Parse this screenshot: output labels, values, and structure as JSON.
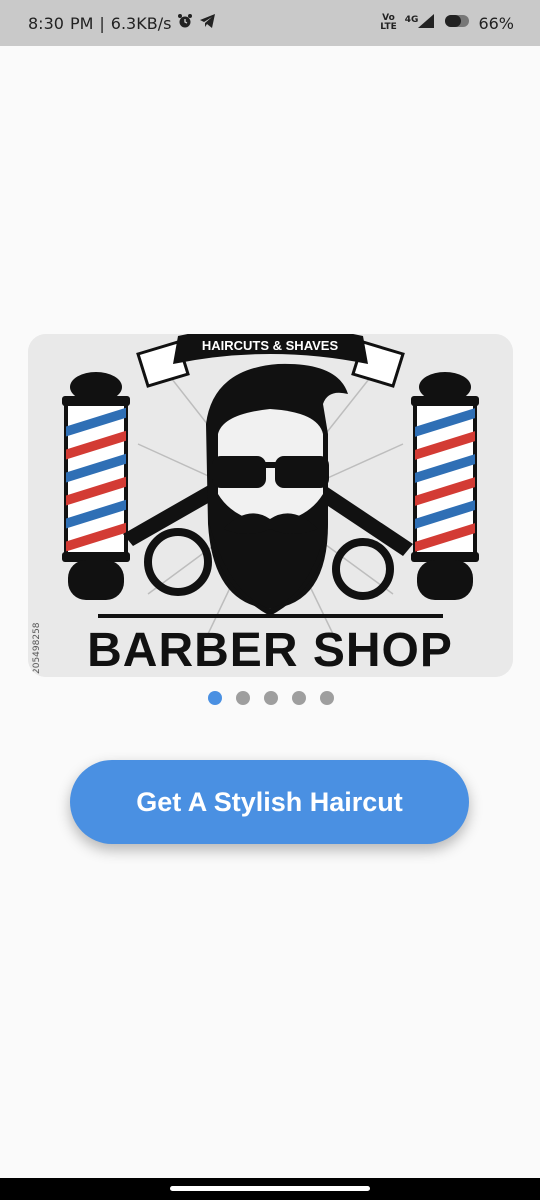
{
  "status_bar": {
    "time": "8:30",
    "ampm": "PM",
    "separator": "|",
    "net_speed": "6.3KB/s",
    "volte_top": "Vo",
    "volte_bottom": "LTE",
    "network_type": "4G",
    "battery": "66%"
  },
  "banner": {
    "top_ribbon": "HAIRCUTS & SHAVES",
    "title": "BARBER SHOP",
    "stock_id": "205498258"
  },
  "carousel": {
    "total": 5,
    "active_index": 0
  },
  "cta": {
    "label": "Get A Stylish Haircut"
  },
  "colors": {
    "accent": "#4a90e2",
    "dot_inactive": "#9e9e9e",
    "status_bar": "#c9c9c9"
  }
}
